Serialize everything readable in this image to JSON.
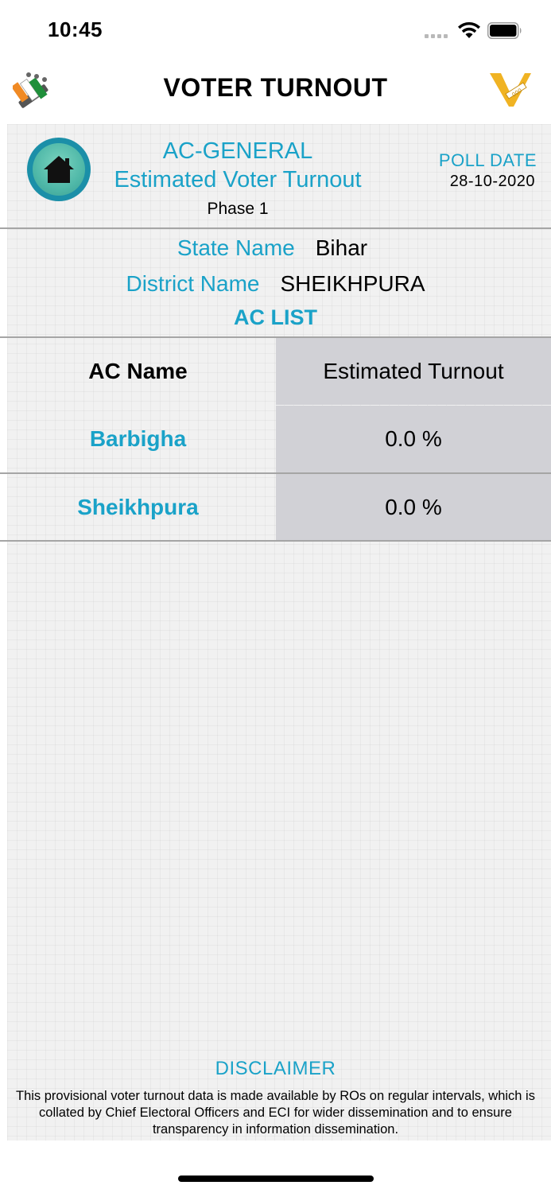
{
  "status_bar": {
    "time": "10:45"
  },
  "nav": {
    "title": "VOTER TURNOUT"
  },
  "header": {
    "election_type": "AC-GENERAL",
    "subtitle": "Estimated Voter Turnout",
    "phase": "Phase 1",
    "poll_date_label": "POLL DATE",
    "poll_date": "28-10-2020"
  },
  "location": {
    "state_label": "State Name",
    "state_value": "Bihar",
    "district_label": "District Name",
    "district_value": "SHEIKHPURA"
  },
  "ac_list_title": "AC LIST",
  "table": {
    "headers": [
      "AC Name",
      "Estimated Turnout"
    ],
    "rows": [
      {
        "name": "Barbigha",
        "turnout": "0.0 %"
      },
      {
        "name": "Sheikhpura",
        "turnout": "0.0 %"
      }
    ]
  },
  "disclaimer": {
    "title": "DISCLAIMER",
    "text": "This provisional voter turnout data is made available by ROs on regular intervals, which is collated by Chief Electoral Officers and ECI for wider dissemination and to ensure transparency in information dissemination."
  },
  "colors": {
    "accent": "#1aa2c8",
    "panel_bg": "#f1f1f1",
    "table_value_bg": "#d1d1d6",
    "home_button": "#1b8fa8",
    "logo_gold": "#f0b323"
  },
  "icons": {
    "home": "home-icon",
    "eci_logo": "eci-logo-icon",
    "app_logo": "v-logo-icon",
    "wifi": "wifi-icon",
    "battery": "battery-icon",
    "signal": "signal-icon"
  }
}
